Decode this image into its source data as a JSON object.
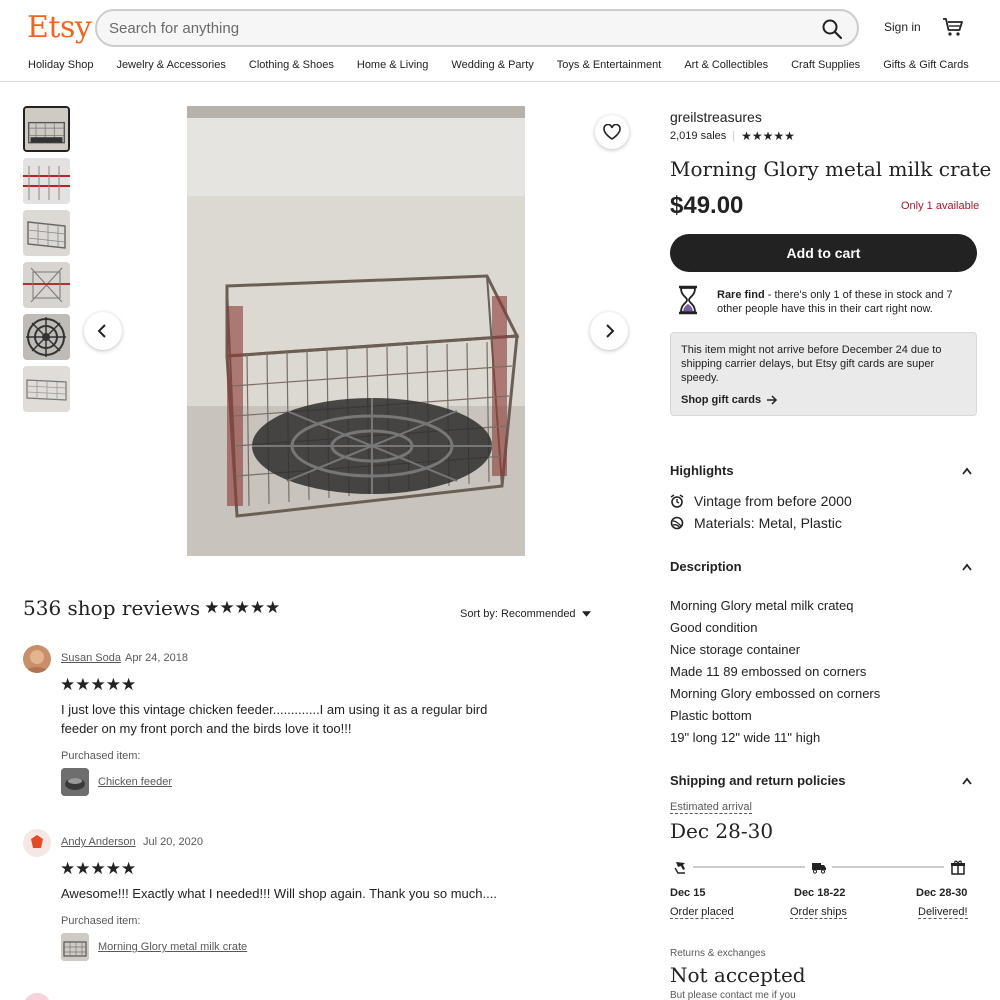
{
  "header": {
    "logo": "Etsy",
    "search_placeholder": "Search for anything",
    "signin": "Sign in",
    "nav": [
      "Holiday Shop",
      "Jewelry & Accessories",
      "Clothing & Shoes",
      "Home & Living",
      "Wedding & Party",
      "Toys & Entertainment",
      "Art & Collectibles",
      "Craft Supplies",
      "Gifts & Gift Cards"
    ]
  },
  "product": {
    "shop_name": "greilstreasures",
    "sales": "2,019 sales",
    "rating_stars": "★★★★★",
    "title": "Morning Glory metal milk crate",
    "price": "$49.00",
    "availability": "Only 1 available",
    "add_to_cart": "Add to cart",
    "rare_bold": "Rare find",
    "rare_text": " - there's only 1 of these in stock and 7 other people have this in their cart right now.",
    "notice_text": "This item might not arrive before December 24 due to shipping carrier delays, but Etsy gift cards are super speedy.",
    "notice_link": "Shop gift cards"
  },
  "highlights": {
    "heading": "Highlights",
    "items": [
      "Vintage from before 2000",
      "Materials: Metal, Plastic"
    ]
  },
  "description": {
    "heading": "Description",
    "lines": [
      "Morning Glory metal milk crateq",
      "Good condition",
      "Nice storage container",
      "Made 11 89 embossed on corners",
      "Morning Glory embossed on corners",
      "Plastic bottom",
      "19\" long 12\" wide 11\" high"
    ]
  },
  "shipping": {
    "heading": "Shipping and return policies",
    "estimated_label": "Estimated arrival",
    "estimated_date": "Dec 28-30",
    "steps": [
      {
        "date": "Dec 15",
        "label": "Order placed"
      },
      {
        "date": "Dec 18-22",
        "label": "Order ships"
      },
      {
        "date": "Dec 28-30",
        "label": "Delivered!"
      }
    ],
    "returns_label": "Returns & exchanges",
    "returns_value": "Not accepted",
    "returns_note": "But please contact me if you"
  },
  "reviews": {
    "title": "536 shop reviews",
    "stars": "★★★★★",
    "sort": "Sort by: Recommended",
    "items": [
      {
        "name": "Susan Soda",
        "date": "Apr 24, 2018",
        "stars": "★★★★★",
        "text": "I just love this vintage chicken feeder.............I am using it as a regular bird feeder on my front porch and the birds love it too!!!",
        "purchased_label": "Purchased item:",
        "item": "Chicken feeder"
      },
      {
        "name": "Andy Anderson",
        "date": "Jul 20, 2020",
        "stars": "★★★★★",
        "text": "Awesome!!! Exactly what I needed!!! Will shop again. Thank you so much....",
        "purchased_label": "Purchased item:",
        "item": "Morning Glory metal milk crate"
      }
    ]
  },
  "colors": {
    "brand": "#f1641e",
    "button": "#222222",
    "availability": "#a61a2e"
  }
}
